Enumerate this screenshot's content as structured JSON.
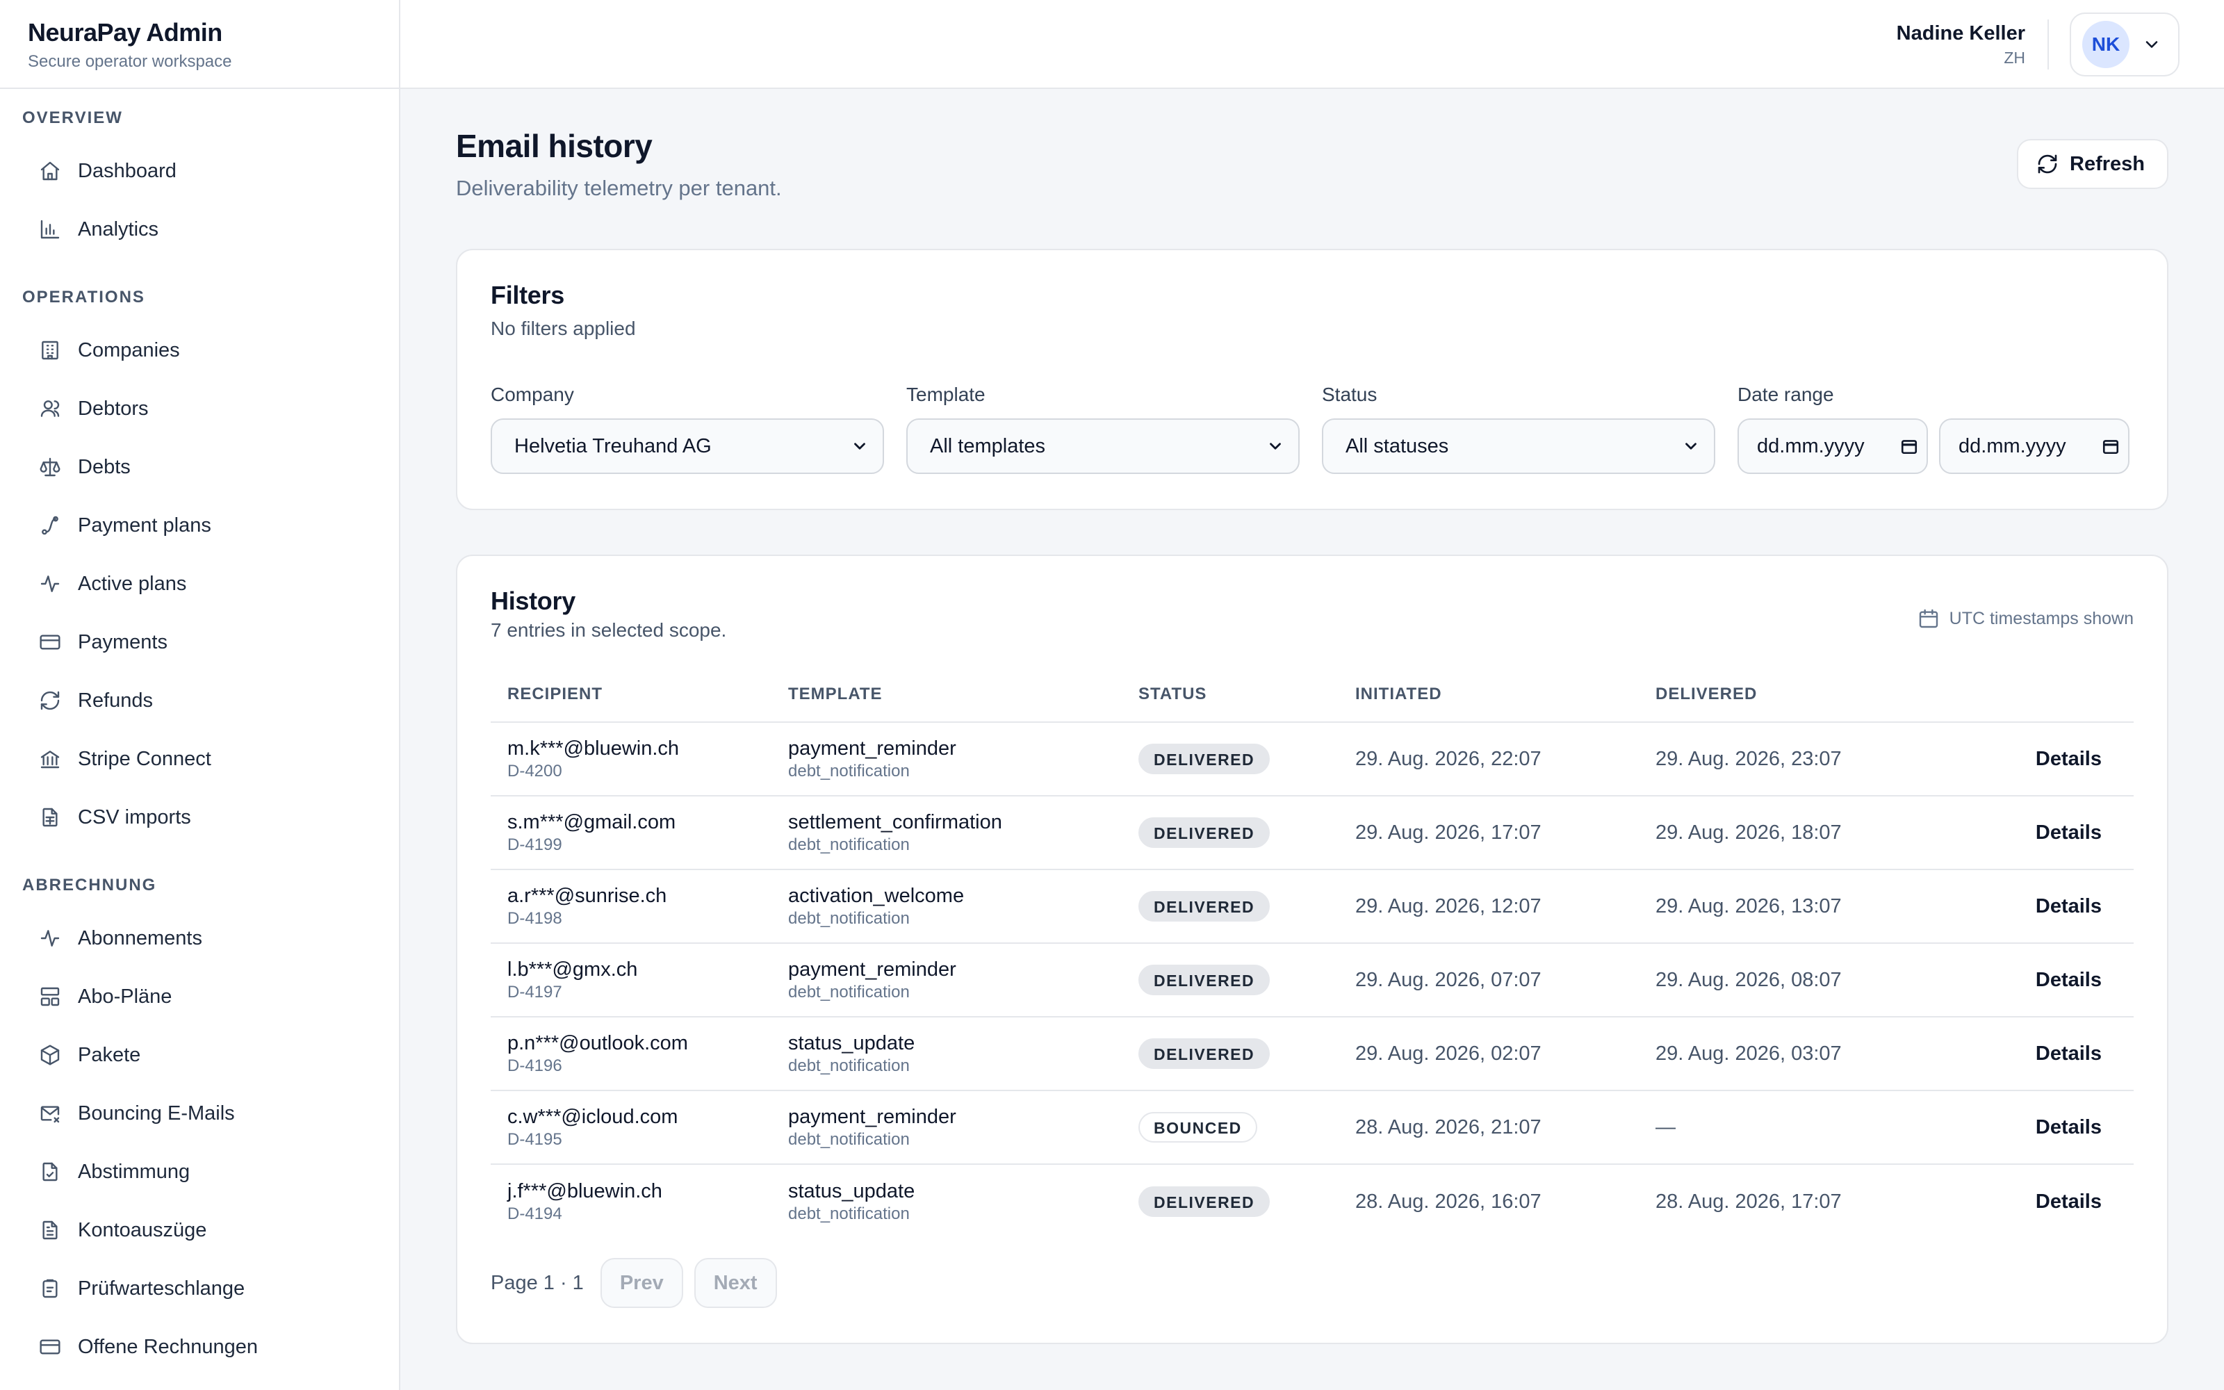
{
  "app": {
    "name": "NeuraPay Admin",
    "tagline": "Secure operator workspace"
  },
  "sidebar": {
    "sections": [
      {
        "title": "Overview",
        "items": [
          {
            "label": "Dashboard",
            "icon": "home-icon"
          },
          {
            "label": "Analytics",
            "icon": "bar-chart-icon"
          }
        ]
      },
      {
        "title": "Operations",
        "items": [
          {
            "label": "Companies",
            "icon": "building-icon"
          },
          {
            "label": "Debtors",
            "icon": "users-icon"
          },
          {
            "label": "Debts",
            "icon": "scale-icon"
          },
          {
            "label": "Payment plans",
            "icon": "route-icon"
          },
          {
            "label": "Active plans",
            "icon": "activity-icon"
          },
          {
            "label": "Payments",
            "icon": "credit-card-icon"
          },
          {
            "label": "Refunds",
            "icon": "refresh-icon"
          },
          {
            "label": "Stripe Connect",
            "icon": "bank-icon"
          },
          {
            "label": "CSV imports",
            "icon": "file-spreadsheet-icon"
          }
        ]
      },
      {
        "title": "Abrechnung",
        "items": [
          {
            "label": "Abonnements",
            "icon": "activity-icon"
          },
          {
            "label": "Abo-Pläne",
            "icon": "layout-icon"
          },
          {
            "label": "Pakete",
            "icon": "package-icon"
          },
          {
            "label": "Bouncing E-Mails",
            "icon": "mail-x-icon"
          },
          {
            "label": "Abstimmung",
            "icon": "file-check-icon"
          },
          {
            "label": "Kontoauszüge",
            "icon": "file-text-icon"
          },
          {
            "label": "Prüfwarteschlange",
            "icon": "clipboard-icon"
          },
          {
            "label": "Offene Rechnungen",
            "icon": "credit-card-icon"
          }
        ]
      }
    ]
  },
  "header": {
    "user_name": "Nadine Keller",
    "user_region": "ZH",
    "avatar_initials": "NK"
  },
  "page": {
    "title": "Email history",
    "subtitle": "Deliverability telemetry per tenant.",
    "refresh_label": "Refresh"
  },
  "filters": {
    "title": "Filters",
    "summary": "No filters applied",
    "company": {
      "label": "Company",
      "value": "Helvetia Treuhand AG"
    },
    "template": {
      "label": "Template",
      "value": "All templates"
    },
    "status": {
      "label": "Status",
      "value": "All statuses"
    },
    "date_range": {
      "label": "Date range",
      "from_placeholder": "dd.mm.yyyy",
      "to_placeholder": "dd.mm.yyyy"
    }
  },
  "history": {
    "title": "History",
    "count_text": "7 entries in selected scope.",
    "utc_note": "UTC timestamps shown",
    "columns": [
      "Recipient",
      "Template",
      "Status",
      "Initiated",
      "Delivered"
    ],
    "action_label": "Details",
    "rows": [
      {
        "recipient": "m.k***@bluewin.ch",
        "debtor_id": "D-4200",
        "template": "payment_reminder",
        "category": "debt_notification",
        "status": "DELIVERED",
        "initiated": "29. Aug. 2026, 22:07",
        "delivered": "29. Aug. 2026, 23:07"
      },
      {
        "recipient": "s.m***@gmail.com",
        "debtor_id": "D-4199",
        "template": "settlement_confirmation",
        "category": "debt_notification",
        "status": "DELIVERED",
        "initiated": "29. Aug. 2026, 17:07",
        "delivered": "29. Aug. 2026, 18:07"
      },
      {
        "recipient": "a.r***@sunrise.ch",
        "debtor_id": "D-4198",
        "template": "activation_welcome",
        "category": "debt_notification",
        "status": "DELIVERED",
        "initiated": "29. Aug. 2026, 12:07",
        "delivered": "29. Aug. 2026, 13:07"
      },
      {
        "recipient": "l.b***@gmx.ch",
        "debtor_id": "D-4197",
        "template": "payment_reminder",
        "category": "debt_notification",
        "status": "DELIVERED",
        "initiated": "29. Aug. 2026, 07:07",
        "delivered": "29. Aug. 2026, 08:07"
      },
      {
        "recipient": "p.n***@outlook.com",
        "debtor_id": "D-4196",
        "template": "status_update",
        "category": "debt_notification",
        "status": "DELIVERED",
        "initiated": "29. Aug. 2026, 02:07",
        "delivered": "29. Aug. 2026, 03:07"
      },
      {
        "recipient": "c.w***@icloud.com",
        "debtor_id": "D-4195",
        "template": "payment_reminder",
        "category": "debt_notification",
        "status": "BOUNCED",
        "initiated": "28. Aug. 2026, 21:07",
        "delivered": "—"
      },
      {
        "recipient": "j.f***@bluewin.ch",
        "debtor_id": "D-4194",
        "template": "status_update",
        "category": "debt_notification",
        "status": "DELIVERED",
        "initiated": "28. Aug. 2026, 16:07",
        "delivered": "28. Aug. 2026, 17:07"
      }
    ],
    "pagination": {
      "text": "Page 1 · 1",
      "prev_label": "Prev",
      "next_label": "Next"
    }
  },
  "colors": {
    "background": "#f4f6f9",
    "surface": "#ffffff",
    "border": "#e5e7eb",
    "text_primary": "#0f172a",
    "text_muted": "#64748b",
    "avatar_bg": "#dbe6ff",
    "avatar_text": "#1d4ed8"
  }
}
